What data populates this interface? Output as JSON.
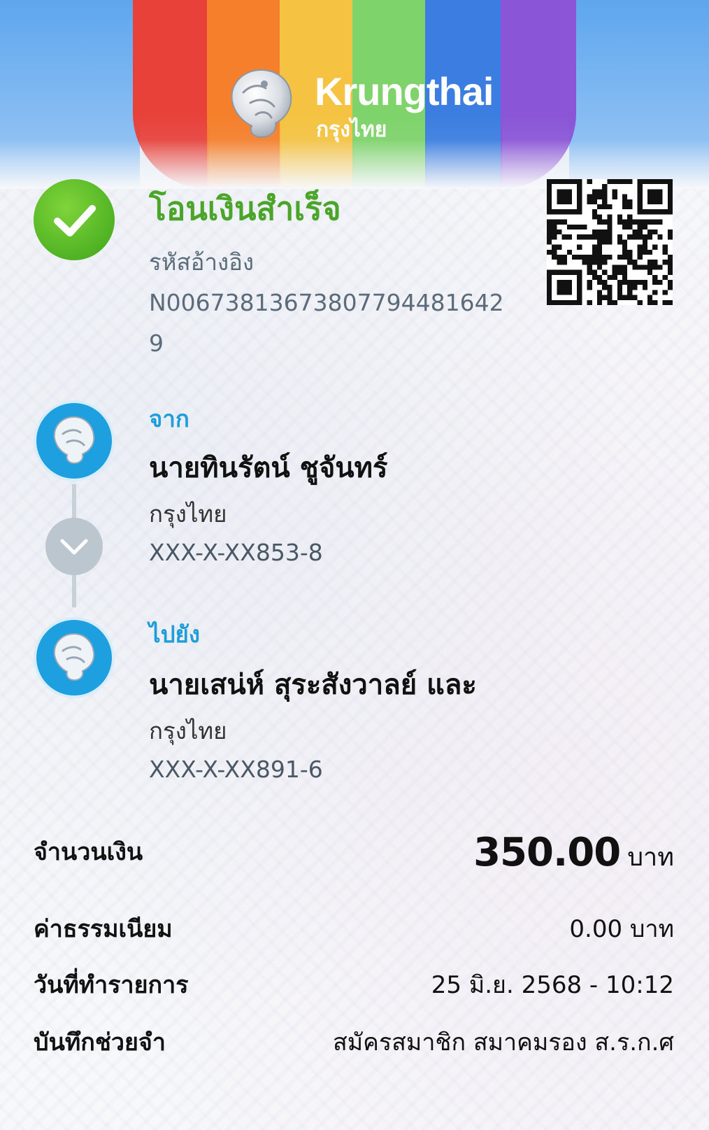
{
  "brand": {
    "name_en": "Krungthai",
    "name_th": "กรุงไทย",
    "stripe_colors": [
      "#e8413a",
      "#f57f2a",
      "#f5c341",
      "#7ed36a",
      "#3b7de0",
      "#8a55d6"
    ]
  },
  "status": {
    "title": "โอนเงินสำเร็จ",
    "ref_label": "รหัสอ้างอิง",
    "ref_value": "N006738136738077944816429",
    "icon": "check-icon",
    "color": "#4aa52a"
  },
  "from": {
    "label": "จาก",
    "name": "นายทินรัตน์ ชูจันทร์",
    "bank": "กรุงไทย",
    "account": "XXX-X-XX853-8"
  },
  "to": {
    "label": "ไปยัง",
    "name": "นายเสน่ห์ สุระสังวาลย์ และ",
    "bank": "กรุงไทย",
    "account": "XXX-X-XX891-6"
  },
  "details": {
    "amount_label": "จำนวนเงิน",
    "amount_value": "350.00",
    "amount_unit": "บาท",
    "fee_label": "ค่าธรรมเนียม",
    "fee_value": "0.00 บาท",
    "date_label": "วันที่ทำรายการ",
    "date_value": "25 มิ.ย. 2568 - 10:12",
    "memo_label": "บันทึกช่วยจำ",
    "memo_value": "สมัครสมาชิก สมาคมรอง ส.ร.ก.ศ"
  }
}
